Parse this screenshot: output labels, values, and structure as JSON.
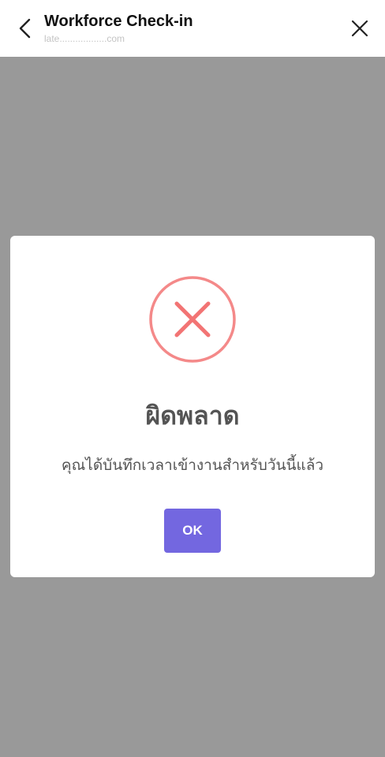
{
  "header": {
    "title": "Workforce Check-in",
    "subtitle": "late..................com",
    "back_icon": "chevron-left-icon",
    "close_icon": "close-icon"
  },
  "dialog": {
    "icon": "error-x-circle-icon",
    "title": "ผิดพลาด",
    "message": "คุณได้บันทึกเวลาเข้างานสำหรับวันนี้แล้ว",
    "ok_label": "OK"
  },
  "colors": {
    "overlay": "#999999",
    "error_icon": "#f27474",
    "ok_button": "#7367e0",
    "text": "#545454"
  }
}
